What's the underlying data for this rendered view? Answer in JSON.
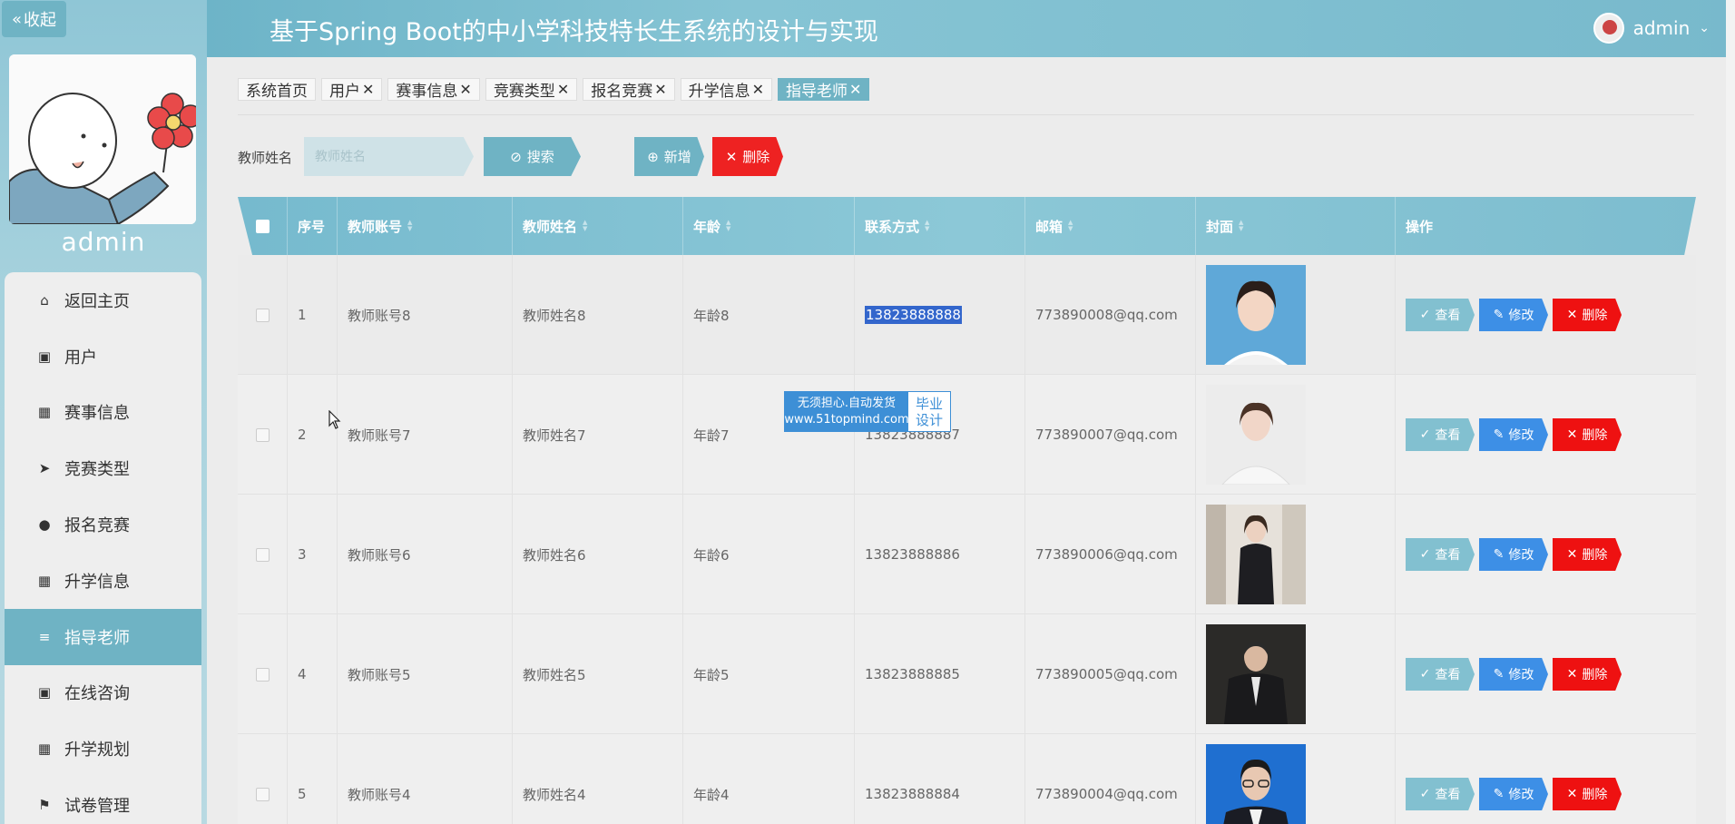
{
  "app": {
    "title": "基于Spring Boot的中小学科技特长生系统的设计与实现",
    "collapse_label": "收起",
    "user": "admin",
    "sidebar_user": "admin"
  },
  "sidebar": {
    "items": [
      {
        "label": "返回主页",
        "icon": "home-icon"
      },
      {
        "label": "用户",
        "icon": "clipboard-icon"
      },
      {
        "label": "赛事信息",
        "icon": "grid-icon"
      },
      {
        "label": "竞赛类型",
        "icon": "send-icon"
      },
      {
        "label": "报名竞赛",
        "icon": "person-icon"
      },
      {
        "label": "升学信息",
        "icon": "grid-icon"
      },
      {
        "label": "指导老师",
        "icon": "list-icon",
        "active": true
      },
      {
        "label": "在线咨询",
        "icon": "clipboard-icon"
      },
      {
        "label": "升学规划",
        "icon": "grid-icon"
      },
      {
        "label": "试卷管理",
        "icon": "flag-icon"
      }
    ]
  },
  "tabs": [
    {
      "label": "系统首页",
      "closable": false
    },
    {
      "label": "用户",
      "closable": true
    },
    {
      "label": "赛事信息",
      "closable": true
    },
    {
      "label": "竞赛类型",
      "closable": true
    },
    {
      "label": "报名竞赛",
      "closable": true
    },
    {
      "label": "升学信息",
      "closable": true
    },
    {
      "label": "指导老师",
      "closable": true,
      "active": true
    }
  ],
  "search": {
    "label": "教师姓名",
    "placeholder": "教师姓名",
    "search_button": "搜索",
    "add_button": "新增",
    "delete_button": "删除"
  },
  "table": {
    "headers": [
      "序号",
      "教师账号",
      "教师姓名",
      "年龄",
      "联系方式",
      "邮箱",
      "封面",
      "操作"
    ],
    "rows": [
      {
        "idx": "1",
        "account": "教师账号8",
        "name": "教师姓名8",
        "age": "年龄8",
        "tel": "13823888888",
        "email": "773890008@qq.com"
      },
      {
        "idx": "2",
        "account": "教师账号7",
        "name": "教师姓名7",
        "age": "年龄7",
        "tel": "13823888887",
        "email": "773890007@qq.com"
      },
      {
        "idx": "3",
        "account": "教师账号6",
        "name": "教师姓名6",
        "age": "年龄6",
        "tel": "13823888886",
        "email": "773890006@qq.com"
      },
      {
        "idx": "4",
        "account": "教师账号5",
        "name": "教师姓名5",
        "age": "年龄5",
        "tel": "13823888885",
        "email": "773890005@qq.com"
      },
      {
        "idx": "5",
        "account": "教师账号4",
        "name": "教师姓名4",
        "age": "年龄4",
        "tel": "13823888884",
        "email": "773890004@qq.com"
      }
    ],
    "actions": {
      "view": "查看",
      "edit": "修改",
      "delete": "删除"
    }
  },
  "ad": {
    "line1": "无须担心.自动发货",
    "line2": "www.51topmind.com",
    "right1": "毕业",
    "right2": "设计"
  },
  "colors": {
    "accent": "#6fb3c4",
    "danger": "#ee2222",
    "edit": "#3d8fe6"
  }
}
